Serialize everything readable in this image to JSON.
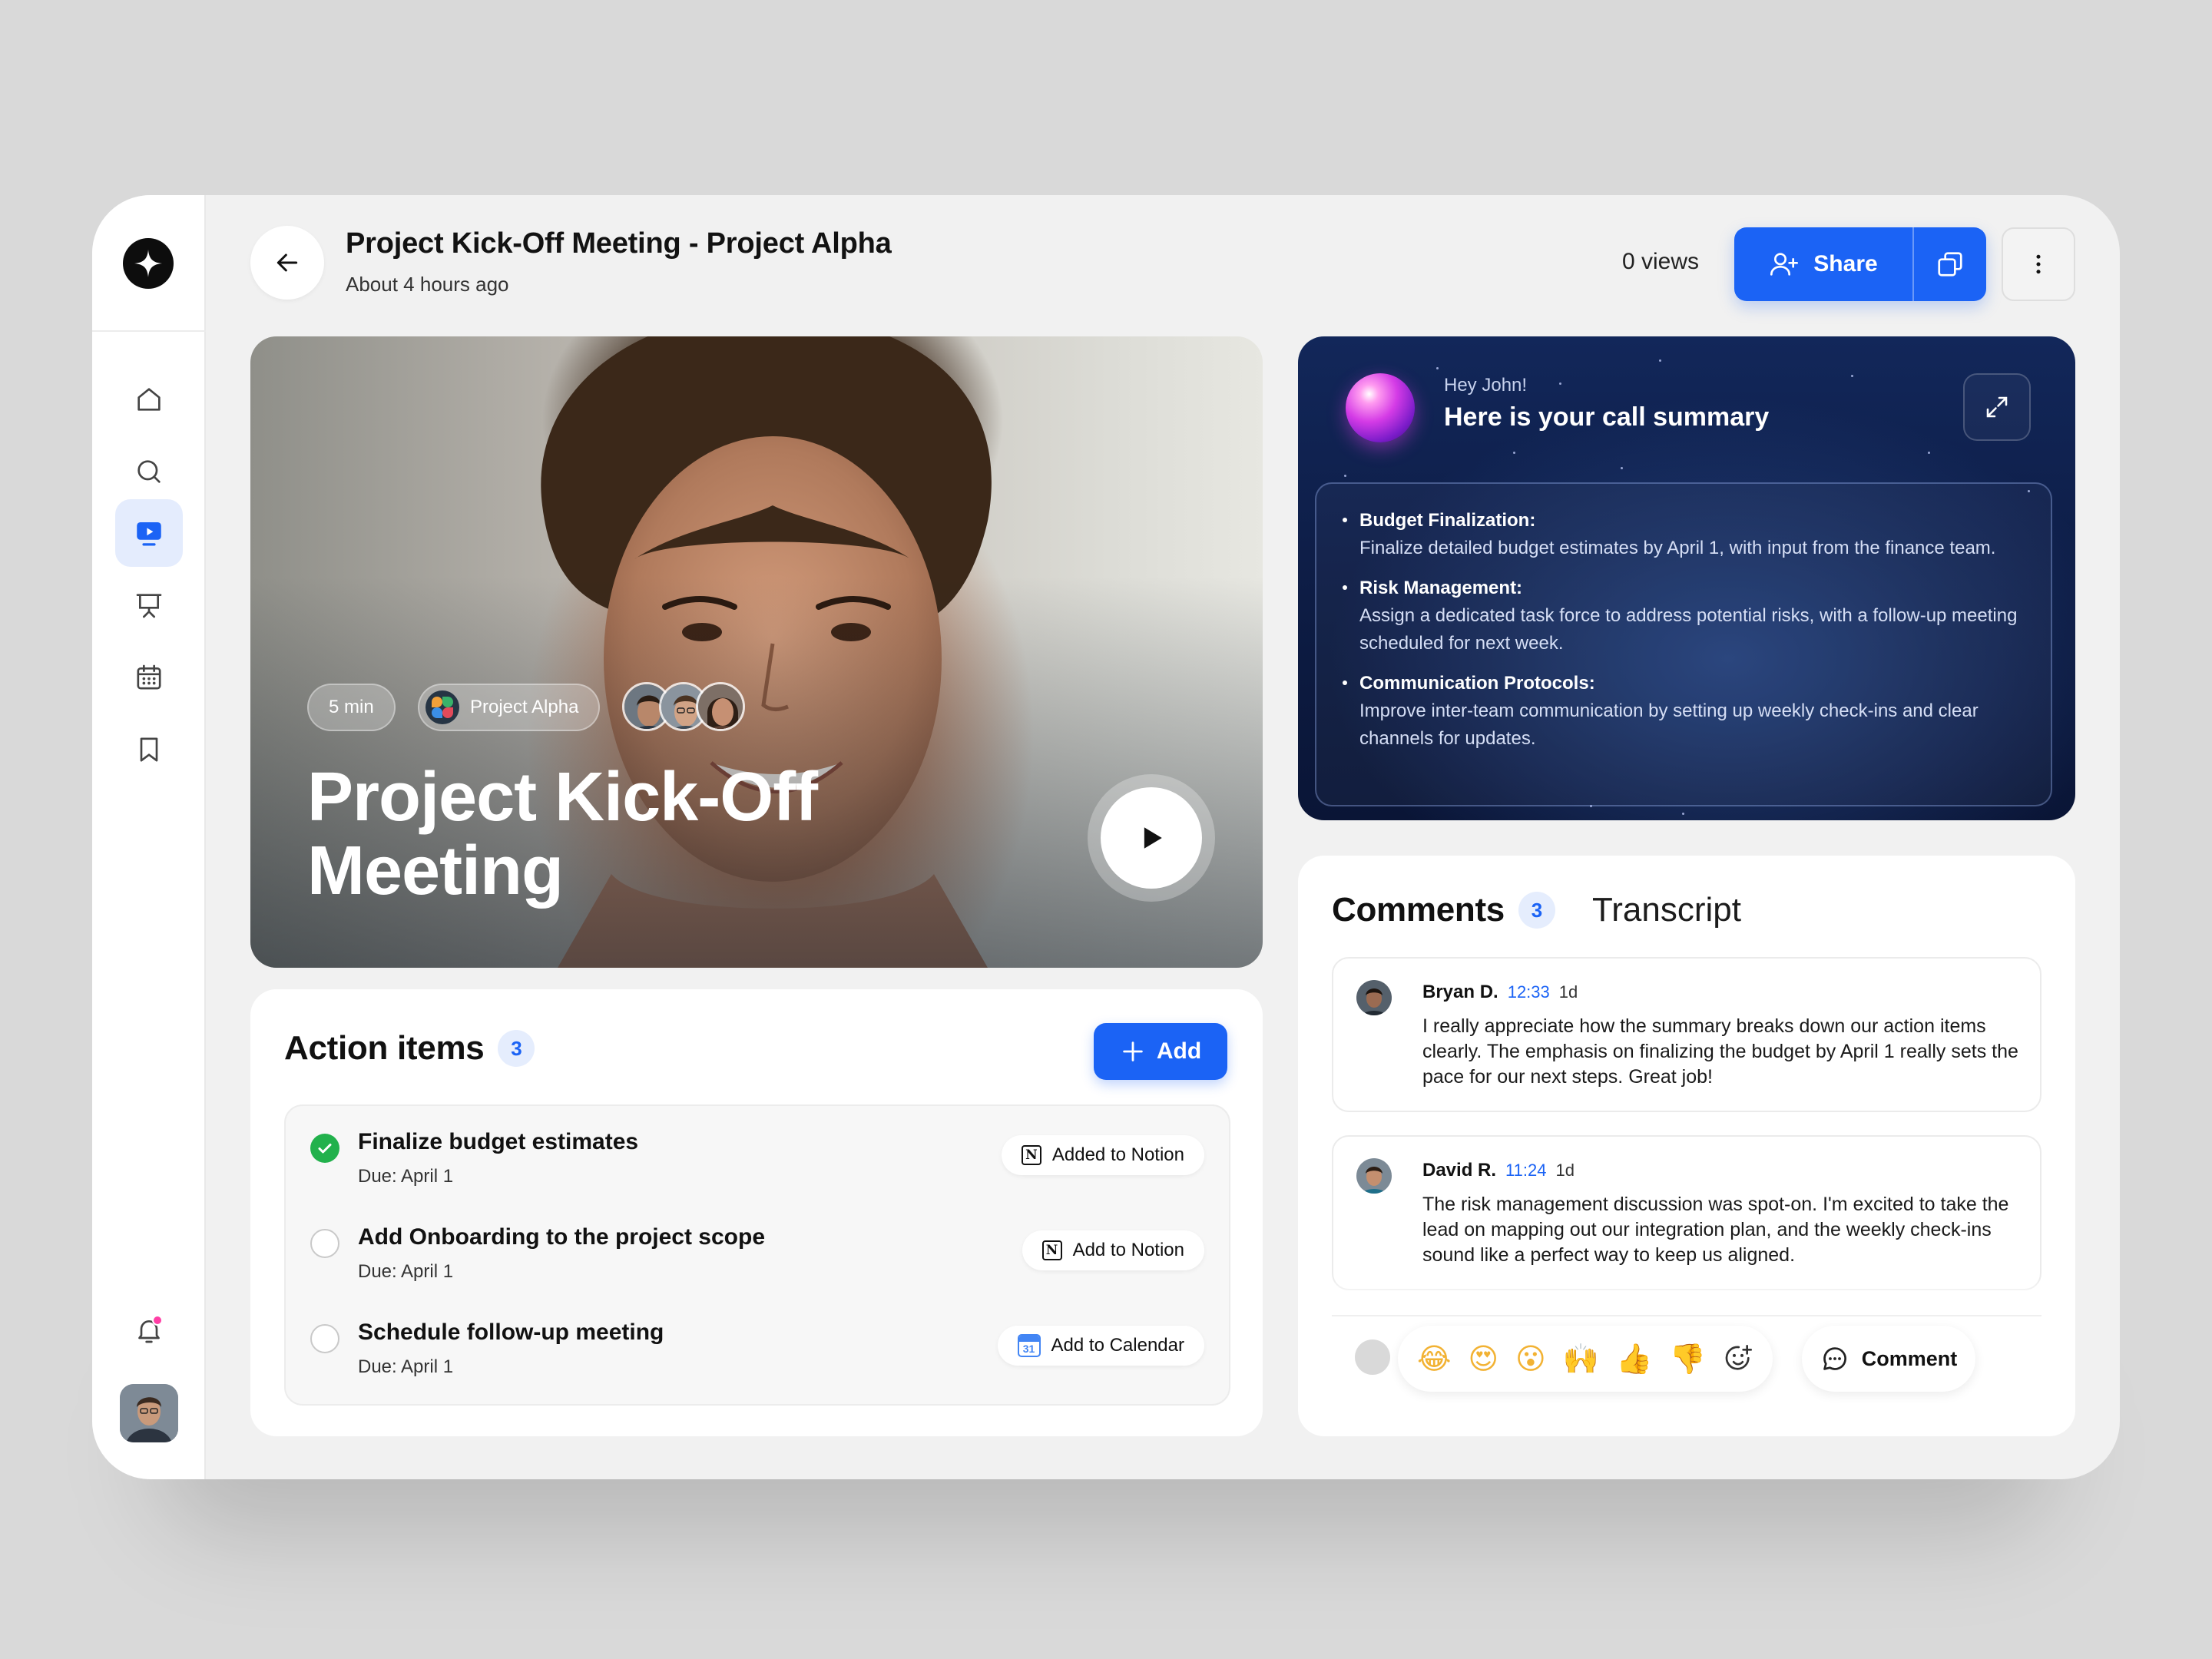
{
  "header": {
    "title": "Project Kick-Off Meeting - Project Alpha",
    "subtitle": "About 4 hours ago",
    "views": "0 views",
    "share_label": "Share"
  },
  "sidebar": {
    "items": [
      {
        "icon": "home-icon"
      },
      {
        "icon": "search-icon"
      },
      {
        "icon": "video-icon",
        "active": true
      },
      {
        "icon": "presentation-icon"
      },
      {
        "icon": "calendar-icon"
      },
      {
        "icon": "bookmark-icon"
      }
    ],
    "bell_icon": "bell-icon",
    "accent": "#1b63f5",
    "notification_dot": "#ff3ea5"
  },
  "video": {
    "duration": "5 min",
    "project": "Project Alpha",
    "title": "Project Kick-Off Meeting"
  },
  "summary": {
    "greeting": "Hey John!",
    "title": "Here is your call summary",
    "points": [
      {
        "head": "Budget Finalization:",
        "body": "Finalize detailed budget estimates by April 1, with input from the finance team."
      },
      {
        "head": "Risk Management:",
        "body": "Assign a dedicated task force to address potential risks, with a follow-up meeting scheduled for next week."
      },
      {
        "head": "Communication Protocols:",
        "body": "Improve inter-team communication by setting up weekly check-ins and clear channels for updates."
      }
    ]
  },
  "action_items": {
    "title": "Action items",
    "count": "3",
    "add_label": "Add",
    "items": [
      {
        "title": "Finalize budget estimates",
        "due": "Due: April 1",
        "tag": "Added to Notion",
        "done": true
      },
      {
        "title": "Add Onboarding to the project scope",
        "due": "Due: April 1",
        "tag": "Add to Notion",
        "done": false
      },
      {
        "title": "Schedule follow-up meeting",
        "due": "Due: April 1",
        "tag": "Add to Calendar",
        "done": false
      }
    ]
  },
  "comments": {
    "tab_label": "Comments",
    "count": "3",
    "transcript_label": "Transcript",
    "items": [
      {
        "name": "Bryan D.",
        "time": "12:33",
        "age": "1d",
        "text": "I really appreciate how the summary breaks down our action items clearly. The emphasis on finalizing the budget by April 1 really sets the pace for our next steps. Great job!"
      },
      {
        "name": "David R.",
        "time": "11:24",
        "age": "1d",
        "text": "The risk management discussion was spot-on. I'm excited to take the lead on mapping out our integration plan, and the weekly check-ins sound like a perfect way to keep us aligned."
      }
    ],
    "reactions": [
      "😂",
      "😍",
      "😮",
      "🙌",
      "👍",
      "👎"
    ],
    "comment_label": "Comment"
  }
}
